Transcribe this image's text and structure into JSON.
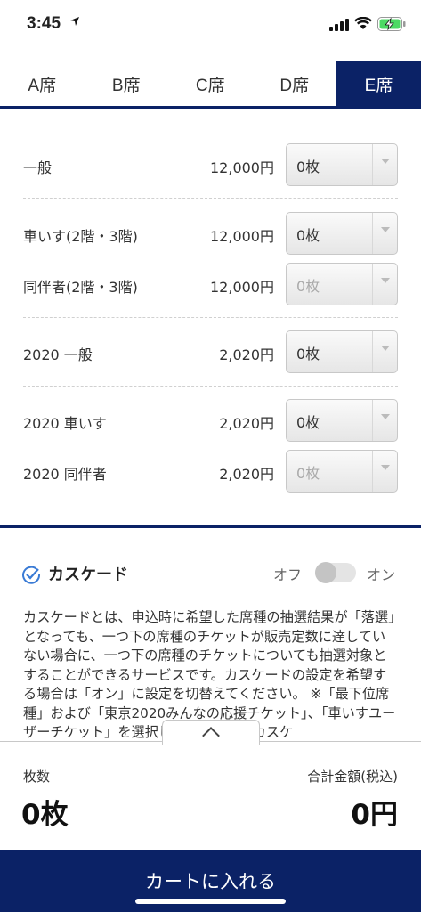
{
  "status_bar": {
    "time": "3:45"
  },
  "tabs": [
    {
      "label": "A席",
      "active": false
    },
    {
      "label": "B席",
      "active": false
    },
    {
      "label": "C席",
      "active": false
    },
    {
      "label": "D席",
      "active": false
    },
    {
      "label": "E席",
      "active": true
    }
  ],
  "tickets": [
    {
      "label": "一般",
      "price": "12,000円",
      "qty": "0枚",
      "enabled": true
    },
    {
      "label": "車いす(2階・3階)",
      "price": "12,000円",
      "qty": "0枚",
      "enabled": true
    },
    {
      "label": "同伴者(2階・3階)",
      "price": "12,000円",
      "qty": "0枚",
      "enabled": false
    },
    {
      "label": "2020 一般",
      "price": "2,020円",
      "qty": "0枚",
      "enabled": true
    },
    {
      "label": "2020 車いす",
      "price": "2,020円",
      "qty": "0枚",
      "enabled": true
    },
    {
      "label": "2020 同伴者",
      "price": "2,020円",
      "qty": "0枚",
      "enabled": false
    }
  ],
  "cascade": {
    "title": "カスケード",
    "toggle_off": "オフ",
    "toggle_on": "オン",
    "description": "カスケードとは、申込時に希望した席種の抽選結果が「落選」となっても、一つ下の席種のチケットが販売定数に達していない場合に、一つ下の席種のチケットについても抽選対象とすることができるサービスです。カスケードの設定を希望する場合は「オン」に設定を切替えてください。 ※「最下位席種」および「東京2020みんなの応援チケット」、「車いすユーザーチケット」を選択している場合はカスケ"
  },
  "summary": {
    "count_label": "枚数",
    "count_value": "0枚",
    "total_label": "合計金額(税込)",
    "total_value": "0円"
  },
  "cart_button": {
    "label": "カートに入れる"
  },
  "colors": {
    "navy": "#0b2266"
  }
}
